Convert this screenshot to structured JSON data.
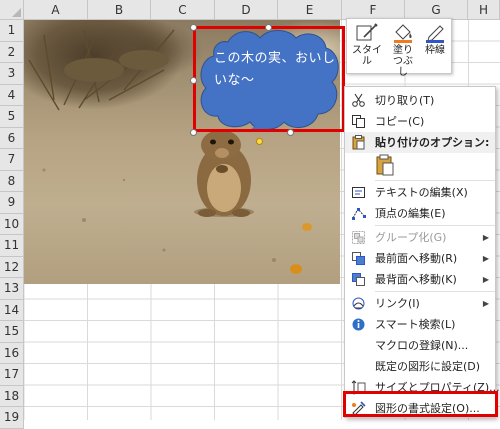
{
  "columns": [
    "A",
    "B",
    "C",
    "D",
    "E",
    "F",
    "G",
    "H"
  ],
  "rows": [
    "1",
    "2",
    "3",
    "4",
    "5",
    "6",
    "7",
    "8",
    "9",
    "10",
    "11",
    "12",
    "13",
    "14",
    "15",
    "16",
    "17",
    "18",
    "19"
  ],
  "bubble_text": "この木の実、おいしいな～",
  "mini_toolbar": {
    "style_label": "スタイル",
    "fill_label": "塗りつぶし",
    "line_label": "枠線"
  },
  "menu": {
    "cut": "切り取り(T)",
    "copy": "コピー(C)",
    "paste_options": "貼り付けのオプション:",
    "edit_text": "テキストの編集(X)",
    "edit_points": "頂点の編集(E)",
    "group": "グループ化(G)",
    "bring_front": "最前面へ移動(R)",
    "send_back": "最背面へ移動(K)",
    "link": "リンク(I)",
    "smart_lookup": "スマート検索(L)",
    "assign_macro": "マクロの登録(N)...",
    "set_default": "既定の図形に設定(D)",
    "size_properties": "サイズとプロパティ(Z)...",
    "format_shape": "図形の書式設定(O)..."
  },
  "colors": {
    "bubble": "#4472c4",
    "highlight": "#e00000",
    "fill_accent": "#f07a1c",
    "line_accent": "#2f55c8"
  }
}
